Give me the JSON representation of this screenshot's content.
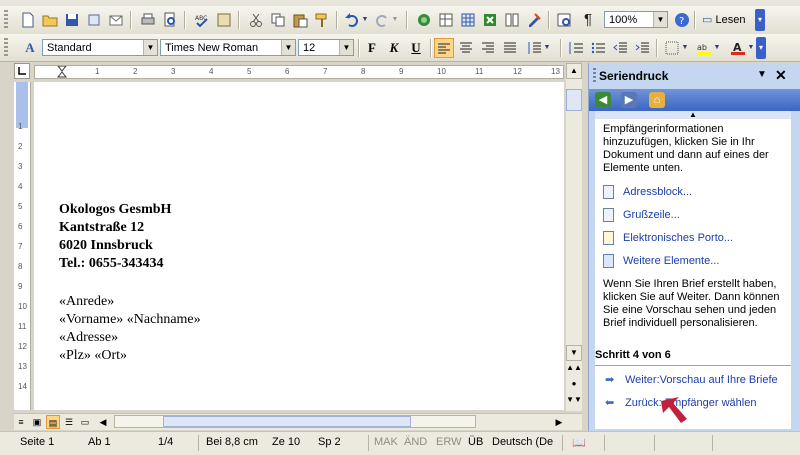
{
  "toolbar_standard": {
    "zoom": "100%",
    "lesen_label": "Lesen"
  },
  "toolbar_format": {
    "style": "Standard",
    "font": "Times New Roman",
    "size": "12",
    "bold": "F",
    "italic": "K",
    "underline": "U"
  },
  "ruler": {
    "h_numbers": [
      "1",
      "2",
      "3",
      "4",
      "5",
      "6",
      "7",
      "8",
      "9",
      "10",
      "11",
      "12",
      "13"
    ],
    "v_numbers": [
      "1",
      "2",
      "3",
      "4",
      "5",
      "6",
      "7",
      "8",
      "9",
      "10",
      "11",
      "12",
      "13",
      "14"
    ]
  },
  "document": {
    "lines": [
      {
        "text": "Okologos GesmbH",
        "bold": true
      },
      {
        "text": "Kantstraße 12",
        "bold": true
      },
      {
        "text": "6020 Innsbruck",
        "bold": true
      },
      {
        "text": "Tel.: 0655-343434",
        "bold": true
      },
      {
        "text": "«Anrede»",
        "bold": false
      },
      {
        "text": "«Vorname» «Nachname»",
        "bold": false
      },
      {
        "text": "«Adresse»",
        "bold": false
      },
      {
        "text": "«Plz» «Ort»",
        "bold": false
      }
    ]
  },
  "task_pane": {
    "title": "Seriendruck",
    "intro": "Empfängerinformationen hinzuzufügen, klicken Sie in Ihr Dokument und dann auf eines der Elemente unten.",
    "items": [
      "Adressblock...",
      "Grußzeile...",
      "Elektronisches Porto...",
      "Weitere Elemente..."
    ],
    "hint": "Wenn Sie Ihren Brief erstellt haben, klicken Sie auf Weiter. Dann können Sie eine Vorschau sehen und jeden Brief individuell personalisieren.",
    "step": "Schritt 4 von 6",
    "next": "Weiter:Vorschau auf Ihre Briefe",
    "back": "Zurück: Empfänger wählen"
  },
  "status_bar": {
    "seite": "Seite  1",
    "ab": "Ab  1",
    "pages": "1/4",
    "bei": "Bei  8,8 cm",
    "ze": "Ze  10",
    "sp": "Sp  2",
    "mak": "MAK",
    "aend": "ÄND",
    "erw": "ERW",
    "ueb": "ÜB",
    "lang": "Deutsch (De"
  },
  "colors": {
    "accent": "#3b66c2",
    "pane_bg": "#c5d7f0",
    "link": "#1c3ea8"
  }
}
